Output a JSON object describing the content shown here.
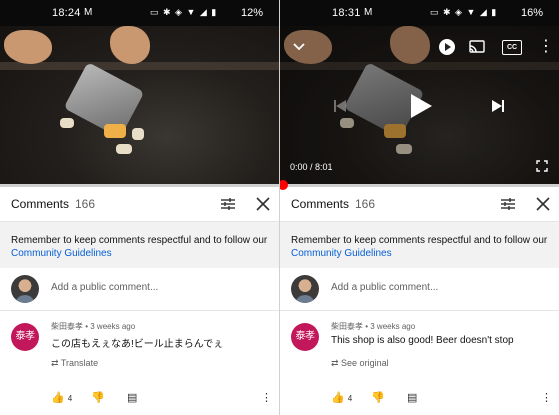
{
  "left_screen": {
    "status_bar": {
      "time": "18:24",
      "mail_icon": "M",
      "sys_icons": "▭ ✱ ◈ ▼ ◢ ▮",
      "battery": "12%"
    },
    "player": {
      "controls_visible": false
    },
    "comments": {
      "title": "Comments",
      "count": "166",
      "notice_text": "Remember to keep comments respectful and to follow our ",
      "notice_link": "Community Guidelines",
      "add_placeholder": "Add a public comment...",
      "comment": {
        "avatar_text": "泰孝",
        "author_meta": "柴田泰孝 • 3 weeks ago",
        "text": "この店もえぇなあ!ビール止まらんでぇ",
        "translate_label": "Translate",
        "likes": "4"
      }
    }
  },
  "right_screen": {
    "status_bar": {
      "time": "18:31",
      "mail_icon": "M",
      "sys_icons": "▭ ✱ ◈ ▼ ◢ ▮",
      "battery": "16%"
    },
    "player": {
      "controls_visible": true,
      "time_readout": "0:00 / 8:01",
      "cc_label": "CC"
    },
    "comments": {
      "title": "Comments",
      "count": "166",
      "notice_text": "Remember to keep comments respectful and to follow our ",
      "notice_link": "Community Guidelines",
      "add_placeholder": "Add a public comment...",
      "comment": {
        "avatar_text": "泰孝",
        "author_meta": "柴田泰孝 • 3 weeks ago",
        "text": "This shop is also good! Beer doesn't stop",
        "translate_label": "See original",
        "likes": "4"
      }
    }
  },
  "colors": {
    "accent_red": "#ff0000",
    "link_blue": "#065fd4",
    "avatar_pink": "#c2185b"
  },
  "progress_fraction": 0.0
}
